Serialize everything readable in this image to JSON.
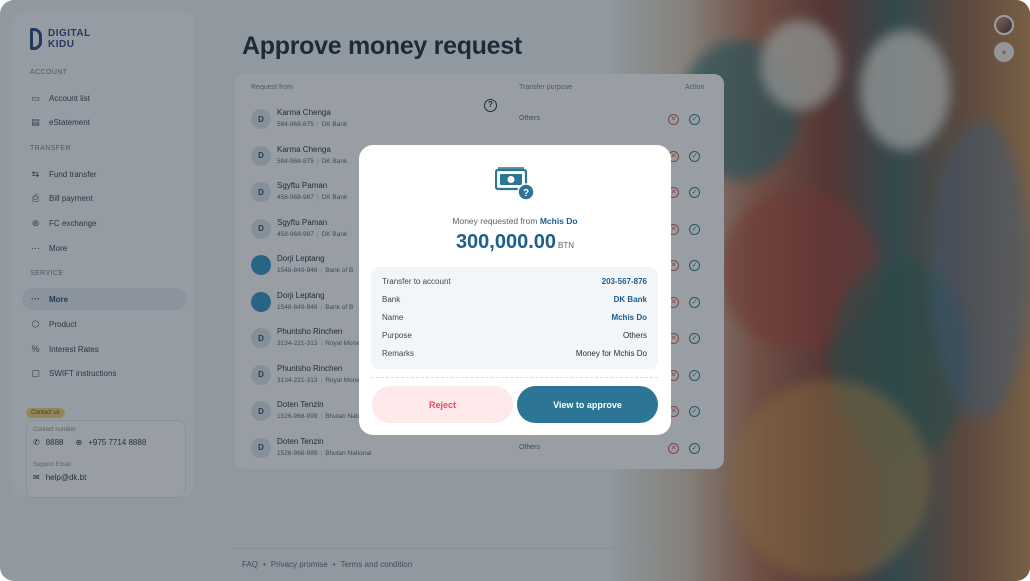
{
  "brand": {
    "line1": "DIGITAL",
    "line2": "KIDU"
  },
  "sidebar": {
    "sections": [
      {
        "label": "ACCOUNT"
      },
      {
        "label": "TRANSFER"
      },
      {
        "label": "SERVICE"
      }
    ],
    "items": [
      {
        "label": "Account list",
        "icon": "account-list-icon"
      },
      {
        "label": "eStatement",
        "icon": "statement-icon"
      },
      {
        "label": "Fund transfer",
        "icon": "transfer-icon"
      },
      {
        "label": "Bill payment",
        "icon": "bill-icon"
      },
      {
        "label": "FC exchange",
        "icon": "exchange-icon"
      },
      {
        "label": "More",
        "icon": "more-icon"
      },
      {
        "label": "More",
        "icon": "more-icon",
        "active": true
      },
      {
        "label": "Product",
        "icon": "product-icon"
      },
      {
        "label": "Interest Rates",
        "icon": "percent-icon"
      },
      {
        "label": "SWIFT instructions",
        "icon": "swift-icon"
      }
    ],
    "contact": {
      "badge": "Contact us",
      "number_label": "Contact number",
      "phone1": "8888",
      "phone2": "+975 7714 8888",
      "email_label": "Support Email",
      "email": "help@dk.bt"
    }
  },
  "page": {
    "title": "Approve money request"
  },
  "table": {
    "headers": {
      "from": "Request from",
      "purpose": "Transfer purpose",
      "action": "Action"
    },
    "rows": [
      {
        "name": "Karma Chenga",
        "acct": "584-968-875",
        "bank": "DK Bank",
        "purpose": "Others",
        "avatar": "logo"
      },
      {
        "name": "Karma Chenga",
        "acct": "584-968-875",
        "bank": "DK Bank",
        "purpose": "",
        "avatar": "logo"
      },
      {
        "name": "Sgyftu Paman",
        "acct": "458-968-987",
        "bank": "DK Bank",
        "purpose": "",
        "avatar": "logo"
      },
      {
        "name": "Sgyftu Paman",
        "acct": "458-968-987",
        "bank": "DK Bank",
        "purpose": "",
        "avatar": "logo"
      },
      {
        "name": "Dorji Leptang",
        "acct": "1548-849-946",
        "bank": "Bank of B",
        "purpose": "",
        "avatar": "blue"
      },
      {
        "name": "Dorji Leptang",
        "acct": "1548-849-946",
        "bank": "Bank of B",
        "purpose": "",
        "avatar": "blue"
      },
      {
        "name": "Phuntsho Rinchen",
        "acct": "3134-221-313",
        "bank": "Royal Mone",
        "purpose": "",
        "avatar": "logo"
      },
      {
        "name": "Phuntsho Rinchen",
        "acct": "3134-221-313",
        "bank": "Royal Mone",
        "purpose": "",
        "avatar": "logo"
      },
      {
        "name": "Doten Tenzin",
        "acct": "1526-968-999",
        "bank": "Bhutan Nationa",
        "purpose": "",
        "avatar": "logo"
      },
      {
        "name": "Doten Tenzin",
        "acct": "1526-968-999",
        "bank": "Bhutan National",
        "purpose": "Others",
        "avatar": "logo"
      }
    ]
  },
  "footer": {
    "faq": "FAQ",
    "privacy": "Privacy promise",
    "terms": "Terms and condition",
    "sep": "•"
  },
  "modal": {
    "from_prefix": "Money requested from",
    "from_name": "Mchis Do",
    "amount": "300,000.00",
    "currency": "BTN",
    "details": [
      {
        "key": "Transfer to account",
        "value": "203-567-876",
        "link": true
      },
      {
        "key": "Bank",
        "value": "DK Bank",
        "link": true
      },
      {
        "key": "Name",
        "value": "Mchis Do",
        "link": true
      },
      {
        "key": "Purpose",
        "value": "Others",
        "link": false
      },
      {
        "key": "Remarks",
        "value": "Money for Mchis Do",
        "link": false
      }
    ],
    "reject_label": "Reject",
    "approve_label": "View to approve"
  },
  "colors": {
    "accent": "#2c7594",
    "reject_bg": "#fde9ea",
    "reject_text": "#e0505a",
    "overlay": "rgba(40,52,64,0.48)"
  }
}
